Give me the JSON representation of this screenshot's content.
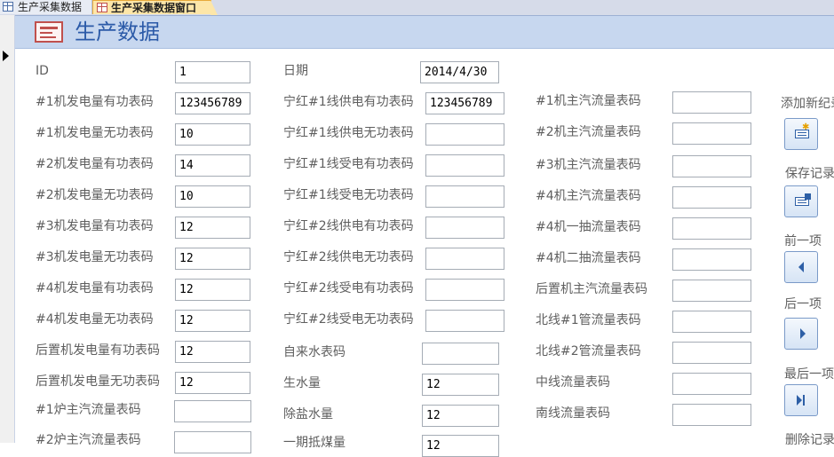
{
  "tabs": [
    {
      "label": "生产采集数据"
    },
    {
      "label": "生产采集数据窗口"
    }
  ],
  "form": {
    "title": "生产数据"
  },
  "fields": {
    "id": {
      "label": "ID",
      "value": "1"
    },
    "date": {
      "label": "日期",
      "value": "2014/4/30"
    },
    "c1": [
      {
        "label": "#1机发电量有功表码",
        "value": "123456789"
      },
      {
        "label": "#1机发电量无功表码",
        "value": "10"
      },
      {
        "label": "#2机发电量有功表码",
        "value": "14"
      },
      {
        "label": "#2机发电量无功表码",
        "value": "10"
      },
      {
        "label": "#3机发电量有功表码",
        "value": "12"
      },
      {
        "label": "#3机发电量无功表码",
        "value": "12"
      },
      {
        "label": "#4机发电量有功表码",
        "value": "12"
      },
      {
        "label": "#4机发电量无功表码",
        "value": "12"
      },
      {
        "label": "后置机发电量有功表码",
        "value": "12"
      },
      {
        "label": "后置机发电量无功表码",
        "value": "12"
      },
      {
        "label": "#1炉主汽流量表码",
        "value": ""
      },
      {
        "label": "#2炉主汽流量表码",
        "value": ""
      }
    ],
    "c2": [
      {
        "label": "宁红#1线供电有功表码",
        "value": "123456789"
      },
      {
        "label": "宁红#1线供电无功表码",
        "value": ""
      },
      {
        "label": "宁红#1线受电有功表码",
        "value": ""
      },
      {
        "label": "宁红#1线受电无功表码",
        "value": ""
      },
      {
        "label": "宁红#2线供电有功表码",
        "value": ""
      },
      {
        "label": "宁红#2线供电无功表码",
        "value": ""
      },
      {
        "label": "宁红#2线受电有功表码",
        "value": ""
      },
      {
        "label": "宁红#2线受电无功表码",
        "value": ""
      },
      {
        "label": "自来水表码",
        "value": ""
      },
      {
        "label": "生水量",
        "value": "12"
      },
      {
        "label": "除盐水量",
        "value": "12"
      },
      {
        "label": "一期抵煤量",
        "value": "12"
      }
    ],
    "c3": [
      {
        "label": "#1机主汽流量表码",
        "value": ""
      },
      {
        "label": "#2机主汽流量表码",
        "value": ""
      },
      {
        "label": "#3机主汽流量表码",
        "value": ""
      },
      {
        "label": "#4机主汽流量表码",
        "value": ""
      },
      {
        "label": "#4机一抽流量表码",
        "value": ""
      },
      {
        "label": "#4机二抽流量表码",
        "value": ""
      },
      {
        "label": "后置机主汽流量表码",
        "value": ""
      },
      {
        "label": "北线#1管流量表码",
        "value": ""
      },
      {
        "label": "北线#2管流量表码",
        "value": ""
      },
      {
        "label": "中线流量表码",
        "value": ""
      },
      {
        "label": "南线流量表码",
        "value": ""
      }
    ]
  },
  "buttons": [
    {
      "label": "添加新纪录",
      "icon": "add-record-icon"
    },
    {
      "label": "保存记录",
      "icon": "save-record-icon"
    },
    {
      "label": "前一项",
      "icon": "previous-record-icon"
    },
    {
      "label": "后一项",
      "icon": "next-record-icon"
    },
    {
      "label": "最后一项",
      "icon": "last-record-icon"
    },
    {
      "label": "删除记录",
      "icon": "delete-record-icon"
    }
  ],
  "colors": {
    "header": "#c7d7ef",
    "title": "#2b5aa8",
    "active_tab": "#fde6a8"
  }
}
